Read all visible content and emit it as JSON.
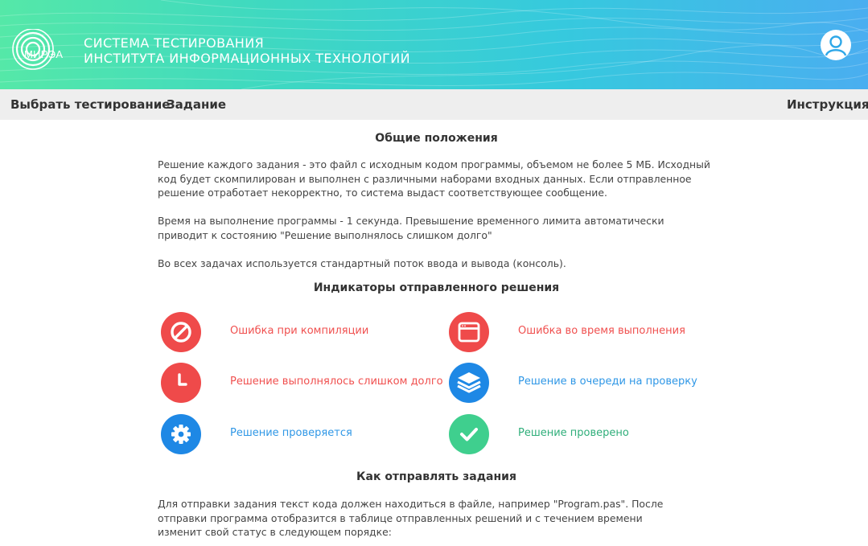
{
  "header": {
    "logo_text": "МИРЭА",
    "title_line1": "СИСТЕМА ТЕСТИРОВАНИЯ",
    "title_line2": "ИНСТИТУТА ИНФОРМАЦИОННЫХ ТЕХНОЛОГИЙ",
    "avatar_icon": "user-icon"
  },
  "nav": {
    "select_test": "Выбрать тестирование",
    "task": "Задание",
    "instruction": "Инструкция"
  },
  "general": {
    "heading": "Общие положения",
    "p1": "Решение каждого задания - это файл с исходным кодом программы, объемом не более 5 МБ. Исходный код будет скомпилирован и выполнен с различными наборами входных данных. Если отправленное решение отработает некорректно, то система выдаст соответствующее сообщение.",
    "p2": "Время на выполнение программы - 1 секунда. Превышение временного лимита автоматически приводит к состоянию \"Решение выполнялось слишком долго\"",
    "p3": "Во всех задачах используется стандартный поток ввода и вывода (консоль)."
  },
  "indicators": {
    "heading": "Индикаторы отправленного решения",
    "items": [
      {
        "label": "Ошибка при компиляции",
        "icon": "forbidden-icon",
        "color": "#ef4a4a"
      },
      {
        "label": "Ошибка во время выполнения",
        "icon": "window-icon",
        "color": "#ef4a4a"
      },
      {
        "label": "Решение выполнялось слишком долго",
        "icon": "clock-icon",
        "color": "#ef4a4a"
      },
      {
        "label": "Решение в очереди на проверку",
        "icon": "layers-icon",
        "color": "#1e88e5"
      },
      {
        "label": "Решение проверяется",
        "icon": "gear-icon",
        "color": "#1e88e5"
      },
      {
        "label": "Решение проверено",
        "icon": "check-icon",
        "color": "#3fcf8e"
      }
    ]
  },
  "howto": {
    "heading": "Как отправлять задания",
    "p1": "Для отправки задания текст кода должен находиться в файле, например \"Program.pas\". После отправки программа отобразится в таблице отправленных решений и с течением времени изменит свой статус в следующем порядке:"
  },
  "colors": {
    "error": "#ef4a4a",
    "info": "#1e88e5",
    "success": "#3fcf8e",
    "label_error": "#f0504f",
    "label_info": "#2f97e6",
    "label_success": "#2fae7a"
  }
}
